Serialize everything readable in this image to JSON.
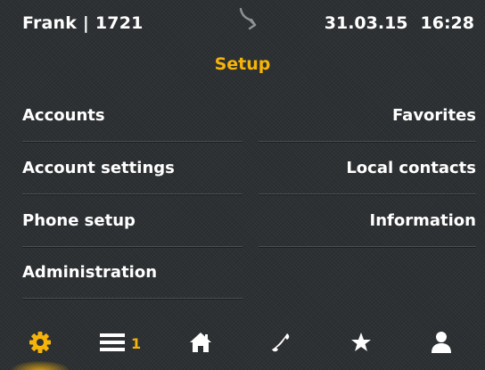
{
  "status_bar": {
    "user": "Frank | 1721",
    "date": "31.03.15",
    "time": "16:28",
    "forward_icon": "call-forward-icon"
  },
  "title": "Setup",
  "menu": {
    "left": [
      {
        "label": "Accounts"
      },
      {
        "label": "Account settings"
      },
      {
        "label": "Phone setup"
      },
      {
        "label": "Administration"
      }
    ],
    "right": [
      {
        "label": "Favorites"
      },
      {
        "label": "Local contacts"
      },
      {
        "label": "Information"
      }
    ]
  },
  "nav": {
    "items": [
      {
        "icon": "gear-icon",
        "active": true
      },
      {
        "icon": "list-icon",
        "badge": "1"
      },
      {
        "icon": "home-icon"
      },
      {
        "icon": "phone-icon"
      },
      {
        "icon": "star-icon"
      },
      {
        "icon": "person-icon"
      }
    ]
  },
  "colors": {
    "accent": "#f6b40a",
    "text": "#ffffff",
    "background": "#2c3032"
  }
}
